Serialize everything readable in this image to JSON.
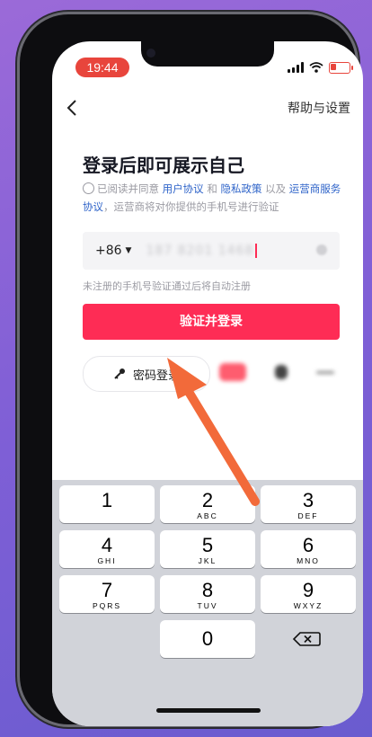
{
  "status_bar": {
    "time": "19:44"
  },
  "nav": {
    "help_label": "帮助与设置"
  },
  "title": "登录后即可展示自己",
  "agreement": {
    "prefix": "已阅读并同意",
    "user_agreement": "用户协议",
    "and": "和",
    "privacy_policy": "隐私政策",
    "and_2": "以及",
    "operator_terms": "运营商服务协议",
    "suffix": "，运营商将对你提供的手机号进行验证"
  },
  "phone_field": {
    "country_code": "+86",
    "value": "187 8201 1468"
  },
  "hint": "未注册的手机号验证通过后将自动注册",
  "login_button": "验证并登录",
  "password_login": "密码登录",
  "keyboard": {
    "keys": [
      {
        "num": "1",
        "letters": ""
      },
      {
        "num": "2",
        "letters": "ABC"
      },
      {
        "num": "3",
        "letters": "DEF"
      },
      {
        "num": "4",
        "letters": "GHI"
      },
      {
        "num": "5",
        "letters": "JKL"
      },
      {
        "num": "6",
        "letters": "MNO"
      },
      {
        "num": "7",
        "letters": "PQRS"
      },
      {
        "num": "8",
        "letters": "TUV"
      },
      {
        "num": "9",
        "letters": "WXYZ"
      },
      {
        "num": "0",
        "letters": ""
      }
    ]
  },
  "colors": {
    "accent": "#fe2c55",
    "link": "#2f64c9",
    "arrow": "#f26a3a"
  }
}
